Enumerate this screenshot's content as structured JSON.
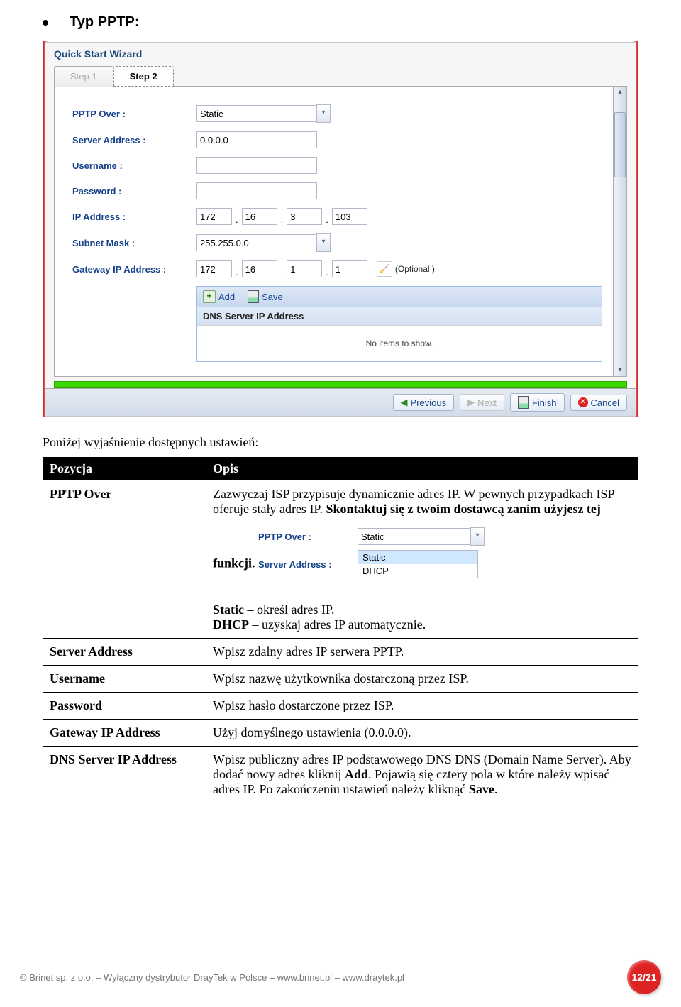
{
  "heading": "Typ PPTP:",
  "wizard": {
    "title": "Quick Start Wizard",
    "tabs": [
      "Step 1",
      "Step 2"
    ],
    "active_tab": 1,
    "fields": {
      "pptp_over": {
        "label": "PPTP Over  :",
        "value": "Static"
      },
      "server_address": {
        "label": "Server Address  :",
        "value": "0.0.0.0"
      },
      "username": {
        "label": "Username  :",
        "value": ""
      },
      "password": {
        "label": "Password  :",
        "value": ""
      },
      "ip_address": {
        "label": "IP Address  :",
        "octets": [
          "172",
          "16",
          "3",
          "103"
        ]
      },
      "subnet_mask": {
        "label": "Subnet Mask  :",
        "value": "255.255.0.0"
      },
      "gateway_ip": {
        "label": "Gateway IP Address  :",
        "octets": [
          "172",
          "16",
          "1",
          "1"
        ],
        "optional_text": "(Optional )"
      }
    },
    "dns_panel": {
      "add": "Add",
      "save": "Save",
      "header": "DNS Server IP Address",
      "empty": "No items to show."
    },
    "footer": {
      "previous": "Previous",
      "next": "Next",
      "finish": "Finish",
      "cancel": "Cancel"
    }
  },
  "intro": "Poniżej wyjaśnienie dostępnych ustawień:",
  "table": {
    "head_left": "Pozycja",
    "head_right": "Opis",
    "rows": [
      {
        "key": "PPTP Over",
        "desc_html": "Zazwyczaj ISP przypisuje dynamicznie adres IP. W pewnych przypadkach ISP oferuje stały adres IP. <b>Skontaktuj się z twoim dostawcą zanim użyjesz tej funkcji.</b>",
        "static_line": "Static – określ adres IP.",
        "dhcp_line": "DHCP – uzyskaj adres IP automatycznie.",
        "static_bold": "Static",
        "dhcp_bold": "DHCP"
      },
      {
        "key": "Server Address",
        "desc": "Wpisz zdalny adres IP serwera PPTP."
      },
      {
        "key": "Username",
        "desc": "Wpisz nazwę użytkownika dostarczoną przez ISP."
      },
      {
        "key": "Password",
        "desc": "Wpisz hasło dostarczone przez ISP."
      },
      {
        "key": "Gateway IP Address",
        "desc": "Użyj domyślnego ustawienia (0.0.0.0)."
      },
      {
        "key": "DNS Server IP Address",
        "desc_html": "Wpisz publiczny adres IP podstawowego DNS DNS (Domain Name Server). Aby dodać nowy adres kliknij <b>Add</b>. Pojawią się cztery pola w które należy wpisać adres IP. Po zakończeniu ustawień należy kliknąć <b>Save</b>."
      }
    ]
  },
  "mini_dropdown": {
    "pptp_over_label": "PPTP Over  :",
    "pptp_over_value": "Static",
    "server_address_label": "Server Address  :",
    "options": [
      "Static",
      "DHCP"
    ]
  },
  "footer": {
    "left": "© Brinet sp. z o.o. – Wyłączny dystrybutor DrayTek w Polsce – www.brinet.pl – www.draytek.pl",
    "page_no": "12/21"
  }
}
